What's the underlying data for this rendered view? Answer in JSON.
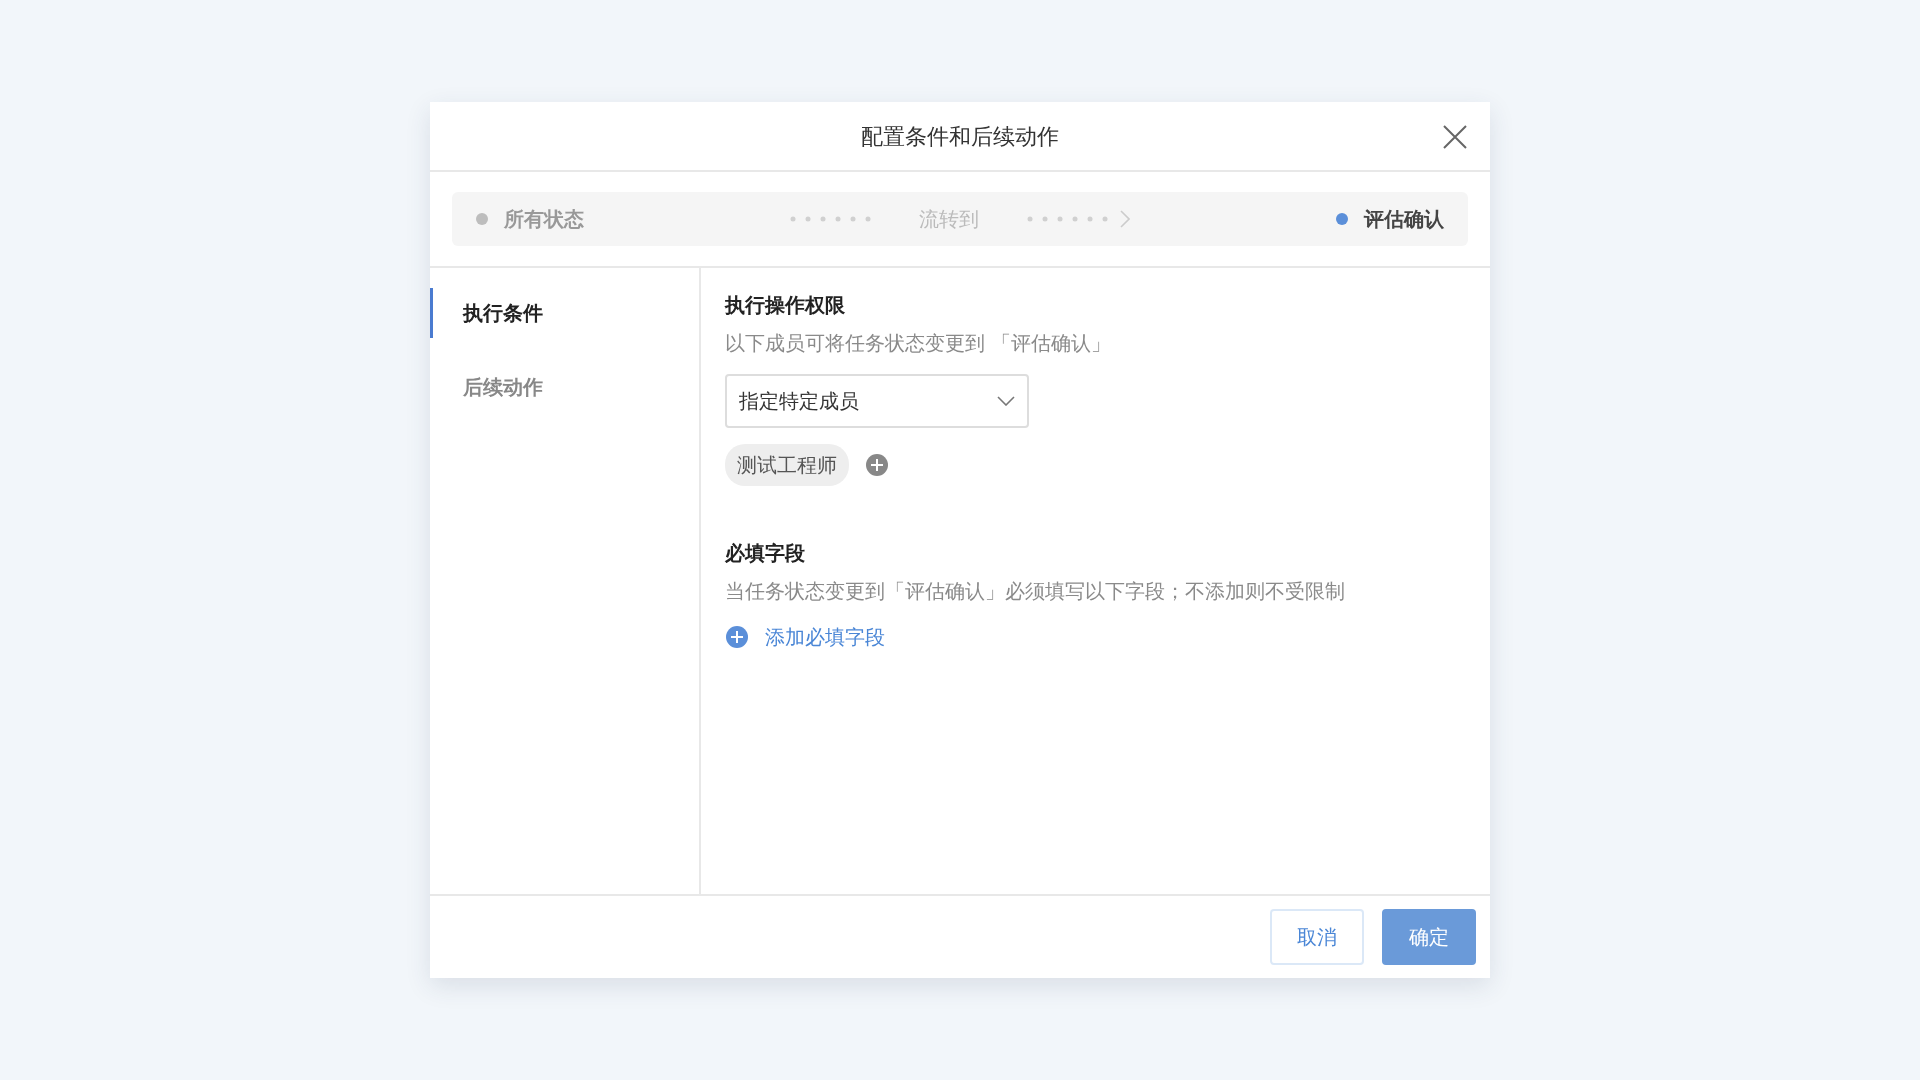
{
  "dialog": {
    "title": "配置条件和后续动作"
  },
  "flow": {
    "from": {
      "label": "所有状态",
      "color": "#bdbdbd"
    },
    "middle": "流转到",
    "to": {
      "label": "评估确认",
      "color": "#5b8fd9"
    }
  },
  "sidebar": {
    "items": [
      {
        "label": "执行条件",
        "selected": true
      },
      {
        "label": "后续动作",
        "selected": false
      }
    ]
  },
  "sections": [
    {
      "title": "执行操作权限",
      "description": "以下成员可将任务状态变更到 「评估确认」",
      "select": {
        "value": "指定特定成员"
      },
      "tags": [
        "测试工程师"
      ]
    },
    {
      "title": "必填字段",
      "description": "当任务状态变更到「评估确认」必须填写以下字段；不添加则不受限制",
      "add_link": "添加必填字段"
    }
  ],
  "buttons": [
    {
      "label": "取消",
      "kind": "secondary"
    },
    {
      "label": "确定",
      "kind": "primary"
    }
  ]
}
